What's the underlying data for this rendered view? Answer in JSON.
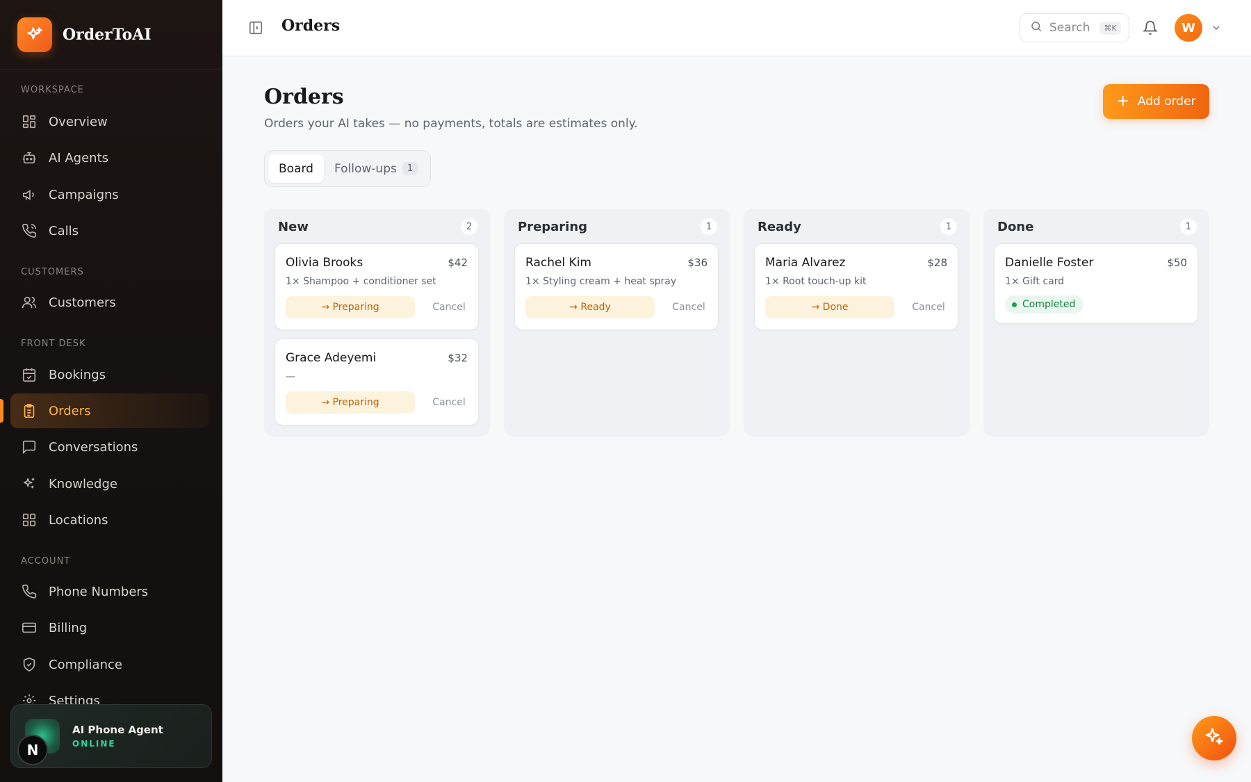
{
  "brand": {
    "name": "OrderToAI",
    "logo_icon": "sparkles-icon"
  },
  "sidebar": {
    "sections": {
      "workspace": "WORKSPACE",
      "customers": "CUSTOMERS",
      "front_desk": "FRONT DESK",
      "account": "ACCOUNT"
    },
    "items": [
      {
        "label": "Overview",
        "icon": "grid-icon"
      },
      {
        "label": "AI Agents",
        "icon": "bot-icon"
      },
      {
        "label": "Campaigns",
        "icon": "megaphone-icon"
      },
      {
        "label": "Calls",
        "icon": "phone-call-icon"
      },
      {
        "label": "Customers",
        "icon": "users-icon"
      },
      {
        "label": "Bookings",
        "icon": "calendar-check-icon"
      },
      {
        "label": "Orders",
        "icon": "clipboard-list-icon",
        "active": true
      },
      {
        "label": "Conversations",
        "icon": "message-square-icon"
      },
      {
        "label": "Knowledge",
        "icon": "sparkles-icon"
      },
      {
        "label": "Locations",
        "icon": "grid-icon"
      },
      {
        "label": "Phone Numbers",
        "icon": "phone-icon"
      },
      {
        "label": "Billing",
        "icon": "credit-card-icon"
      },
      {
        "label": "Compliance",
        "icon": "shield-check-icon"
      },
      {
        "label": "Settings",
        "icon": "gear-icon"
      }
    ],
    "agent": {
      "name": "AI Phone Agent",
      "status": "ONLINE"
    },
    "n_badge": "N"
  },
  "header": {
    "title": "Orders",
    "search_placeholder": "Search",
    "search_shortcut": "⌘K",
    "avatar_initial": "W"
  },
  "main": {
    "title": "Orders",
    "subtitle": "Orders your AI takes — no payments, totals are estimates only.",
    "add_button": "Add order",
    "tabs": [
      {
        "label": "Board",
        "active": true
      },
      {
        "label": "Follow-ups",
        "count": "1"
      }
    ],
    "columns": [
      {
        "title": "New",
        "count": "2",
        "cards": [
          {
            "name": "Olivia Brooks",
            "price": "$42",
            "items": "1× Shampoo + conditioner set",
            "action": "→ Preparing",
            "cancel": "Cancel"
          },
          {
            "name": "Grace Adeyemi",
            "price": "$32",
            "items": "—",
            "action": "→ Preparing",
            "cancel": "Cancel"
          }
        ]
      },
      {
        "title": "Preparing",
        "count": "1",
        "cards": [
          {
            "name": "Rachel Kim",
            "price": "$36",
            "items": "1× Styling cream + heat spray",
            "action": "→ Ready",
            "cancel": "Cancel"
          }
        ]
      },
      {
        "title": "Ready",
        "count": "1",
        "cards": [
          {
            "name": "Maria Alvarez",
            "price": "$28",
            "items": "1× Root touch-up kit",
            "action": "→ Done",
            "cancel": "Cancel"
          }
        ]
      },
      {
        "title": "Done",
        "count": "1",
        "cards": [
          {
            "name": "Danielle Foster",
            "price": "$50",
            "items": "1× Gift card",
            "status": "Completed"
          }
        ]
      }
    ]
  },
  "colors": {
    "accent": "#f7821e",
    "sidebar_bg": "#161210",
    "success": "#16a34a"
  }
}
